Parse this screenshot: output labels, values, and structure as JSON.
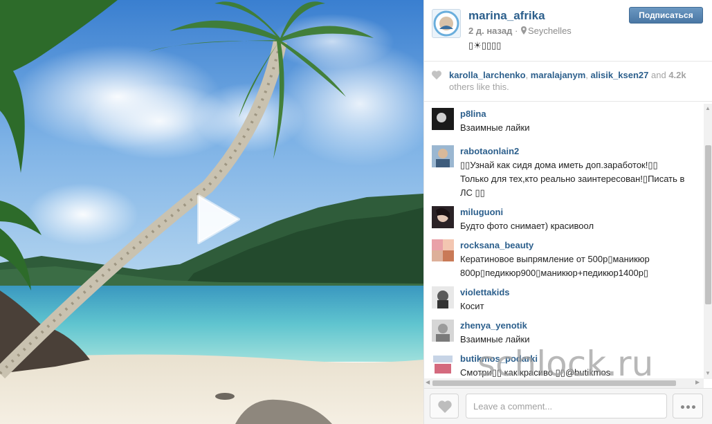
{
  "post": {
    "username": "marina_afrika",
    "time": "2 д. назад",
    "separator": "·",
    "location": "Seychelles",
    "caption": "▯☀▯▯▯▯",
    "follow_label": "Подписаться"
  },
  "likes": {
    "users": [
      "karolla_larchenko",
      "maralajanym",
      "alisik_ksen27"
    ],
    "separator": ", ",
    "and_text": " and ",
    "count": "4.2k",
    "suffix": " others like this."
  },
  "comments": [
    {
      "user": "p8lina",
      "text": "Взаимные лайки"
    },
    {
      "user": "rabotaonlain2",
      "text": "▯▯Узнай как сидя дома иметь доп.заработок!▯▯ Только для тех,кто реально заинтересован!▯Писать в ЛС ▯▯"
    },
    {
      "user": "miluguoni",
      "text": "Будто фото снимает) красивоол"
    },
    {
      "user": "rocksana_beauty",
      "text": "Кератиновое выпрямление от 500р▯маникюр 800р▯педикюр900▯маникюр+педикюр1400р▯"
    },
    {
      "user": "violettakids",
      "text": "Косит"
    },
    {
      "user": "zhenya_yenotik",
      "text": "Взаимные лайки"
    },
    {
      "user": "butikmos_podarki",
      "text": "Смотри▯▯ как красиво ▯▯@butikmos"
    }
  ],
  "footer": {
    "comment_placeholder": "Leave a comment..."
  },
  "watermark": "schlock.ru",
  "icons": {
    "play": "play-icon",
    "location": "location-pin-icon",
    "heart": "heart-icon",
    "more": "more-dots-icon"
  },
  "colors": {
    "link": "#2c5f8c",
    "follow_button": "#4a77a4",
    "muted": "#a3a3a3"
  }
}
